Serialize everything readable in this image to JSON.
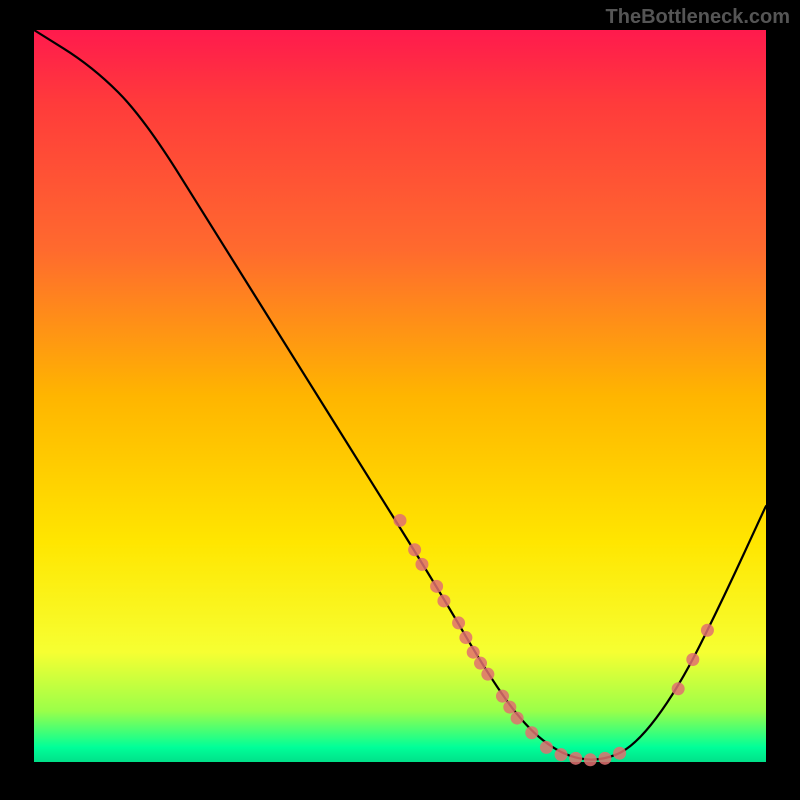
{
  "watermark": "TheBottleneck.com",
  "chart_data": {
    "type": "line",
    "title": "",
    "xlabel": "",
    "ylabel": "",
    "xlim": [
      0,
      100
    ],
    "ylim": [
      0,
      100
    ],
    "curve": [
      {
        "x": 0,
        "y": 100
      },
      {
        "x": 8,
        "y": 95
      },
      {
        "x": 15,
        "y": 88
      },
      {
        "x": 25,
        "y": 72
      },
      {
        "x": 35,
        "y": 56
      },
      {
        "x": 45,
        "y": 40
      },
      {
        "x": 55,
        "y": 24
      },
      {
        "x": 62,
        "y": 12
      },
      {
        "x": 67,
        "y": 5
      },
      {
        "x": 72,
        "y": 1
      },
      {
        "x": 77,
        "y": 0
      },
      {
        "x": 82,
        "y": 2
      },
      {
        "x": 88,
        "y": 10
      },
      {
        "x": 94,
        "y": 22
      },
      {
        "x": 100,
        "y": 35
      }
    ],
    "scatter": [
      {
        "x": 50,
        "y": 33
      },
      {
        "x": 52,
        "y": 29
      },
      {
        "x": 53,
        "y": 27
      },
      {
        "x": 55,
        "y": 24
      },
      {
        "x": 56,
        "y": 22
      },
      {
        "x": 58,
        "y": 19
      },
      {
        "x": 59,
        "y": 17
      },
      {
        "x": 60,
        "y": 15
      },
      {
        "x": 61,
        "y": 13.5
      },
      {
        "x": 62,
        "y": 12
      },
      {
        "x": 64,
        "y": 9
      },
      {
        "x": 65,
        "y": 7.5
      },
      {
        "x": 66,
        "y": 6
      },
      {
        "x": 68,
        "y": 4
      },
      {
        "x": 70,
        "y": 2
      },
      {
        "x": 72,
        "y": 1
      },
      {
        "x": 74,
        "y": 0.5
      },
      {
        "x": 76,
        "y": 0.3
      },
      {
        "x": 78,
        "y": 0.5
      },
      {
        "x": 80,
        "y": 1.2
      },
      {
        "x": 88,
        "y": 10
      },
      {
        "x": 90,
        "y": 14
      },
      {
        "x": 92,
        "y": 18
      }
    ],
    "colors": {
      "curve": "#000000",
      "scatter": "#e07070"
    }
  }
}
